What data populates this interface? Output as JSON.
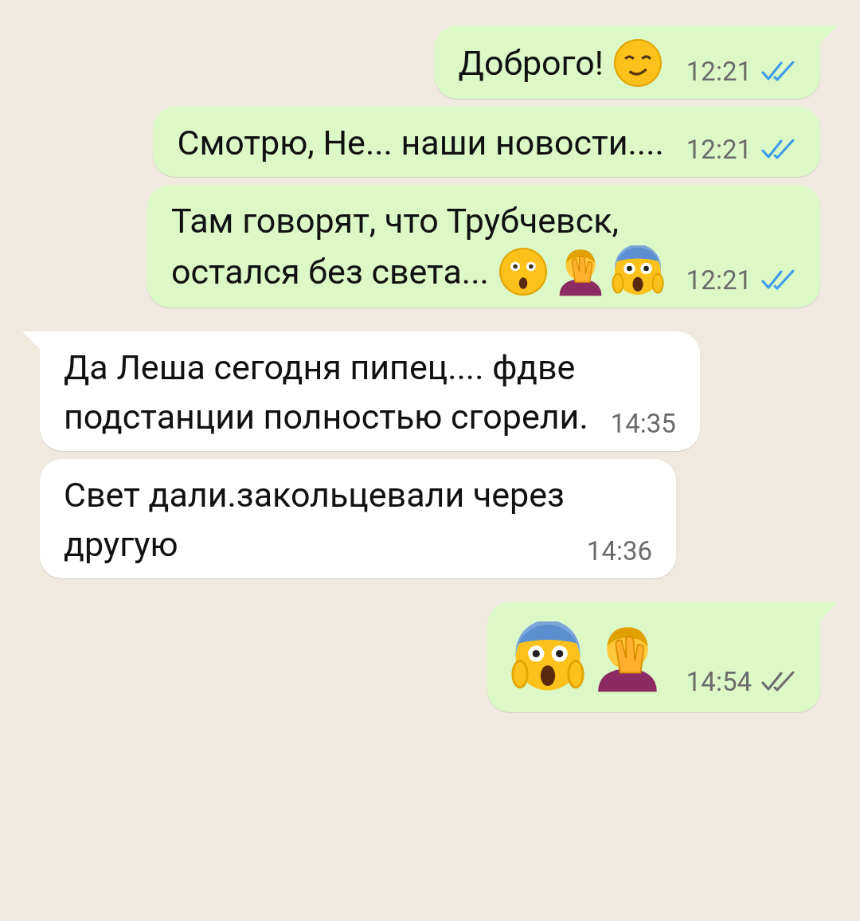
{
  "messages": [
    {
      "kind": "outgoing",
      "lines": [
        "Доброго!"
      ],
      "emojis": [
        {
          "kind": "wink"
        }
      ],
      "time": "12:21",
      "read": true
    },
    {
      "kind": "outgoing",
      "lines": [
        "Смотрю, Не... наши новости...."
      ],
      "time": "12:21",
      "read": true
    },
    {
      "kind": "outgoing",
      "lines": [
        "Там говорят, что Трубчевск,",
        "остался без света..."
      ],
      "emojis": [
        {
          "kind": "astonished"
        },
        {
          "kind": "facepalm"
        },
        {
          "kind": "scream"
        }
      ],
      "time": "12:21",
      "read": true
    },
    {
      "kind": "incoming",
      "lines": [
        "Да Леша сегодня пипец.... фдве",
        "подстанции полностью сгорели."
      ],
      "time": "14:35"
    },
    {
      "kind": "incoming",
      "lines": [
        "Свет дали.закольцевали через",
        "другую"
      ],
      "time": "14:36"
    },
    {
      "kind": "outgoing",
      "emojis": [
        {
          "kind": "scream"
        },
        {
          "kind": "facepalm"
        }
      ],
      "time": "14:54",
      "read": false
    }
  ]
}
